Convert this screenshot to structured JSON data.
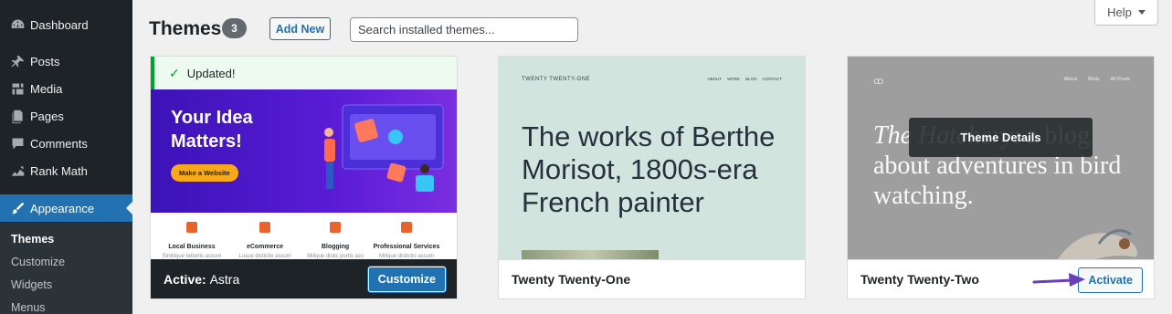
{
  "sidebar": {
    "items": [
      {
        "label": "Dashboard",
        "icon": "dashboard-icon"
      },
      {
        "label": "Posts",
        "icon": "pin-icon"
      },
      {
        "label": "Media",
        "icon": "media-icon"
      },
      {
        "label": "Pages",
        "icon": "pages-icon"
      },
      {
        "label": "Comments",
        "icon": "comments-icon"
      },
      {
        "label": "Rank Math",
        "icon": "rank-math-icon"
      },
      {
        "label": "Appearance",
        "icon": "paintbrush-icon",
        "active": true
      }
    ],
    "submenu": [
      "Themes",
      "Customize",
      "Widgets",
      "Menus"
    ],
    "current_submenu": "Themes"
  },
  "header": {
    "title": "Themes",
    "count": "3",
    "add_new_label": "Add New",
    "search_placeholder": "Search installed themes...",
    "help_label": "Help"
  },
  "themes": [
    {
      "name": "Astra",
      "active_prefix": "Active:",
      "updated_notice": "Updated!",
      "button_label": "Customize",
      "preview": {
        "headline": "Your Idea Matters!",
        "cta": "Make a Website",
        "features": [
          {
            "title": "Local Business",
            "desc": "Similique lobortis assum"
          },
          {
            "title": "eCommerce",
            "desc": "Lusue distictio assum"
          },
          {
            "title": "Blogging",
            "desc": "Milique distic portis ass"
          },
          {
            "title": "Professional Services",
            "desc": "Milique distictio assum"
          }
        ]
      }
    },
    {
      "name": "Twenty Twenty-One",
      "preview": {
        "site_title": "TWENTY TWENTY-ONE",
        "nav": [
          "ABOUT",
          "WORK",
          "BLOG",
          "CONTACT"
        ],
        "headline": "The works of Berthe Morisot, 1800s-era French painter"
      }
    },
    {
      "name": "Twenty Twenty-Two",
      "button_label": "Activate",
      "details_label": "Theme Details",
      "preview": {
        "logo": "ꝏ",
        "nav": [
          "About",
          "Birds",
          "All Posts"
        ],
        "headline_italic": "The Hatchery",
        "headline_rest": ": a blog about adventures in bird watching."
      }
    }
  ],
  "colors": {
    "sidebar_bg": "#1d2327",
    "accent": "#2271b1",
    "success": "#00a32a",
    "astra_purple": "#3b13b7",
    "tt1_bg": "#d1e4dd",
    "tt2_bg": "#9e9e9e",
    "arrow": "#6b3fb8"
  }
}
